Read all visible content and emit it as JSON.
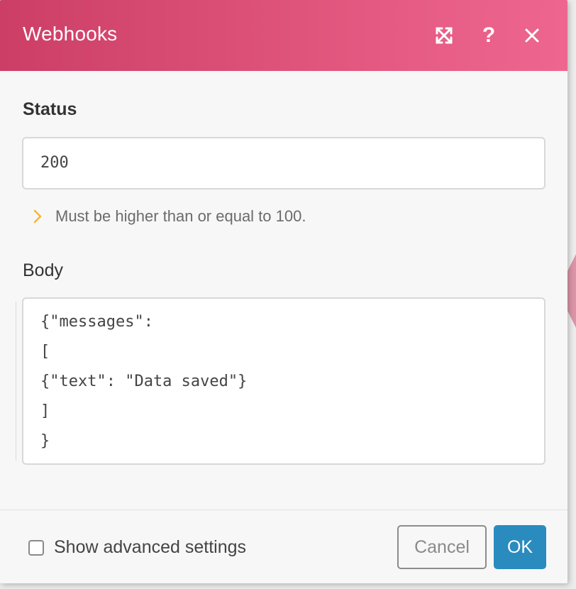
{
  "dialog": {
    "title": "Webhooks",
    "header_color": "#e0557c",
    "icons": {
      "expand": "expand-icon",
      "help": "help-icon",
      "close": "close-icon"
    },
    "help_glyph": "?"
  },
  "status": {
    "label": "Status",
    "value": "200",
    "hint": "Must be higher than or equal to 100.",
    "hint_icon": "chevron-right-icon",
    "hint_color": "#f5b82e"
  },
  "body": {
    "label": "Body",
    "lines": [
      "{\"messages\":",
      "[",
      "{\"text\": \"Data saved\"}",
      "]",
      "}"
    ]
  },
  "footer": {
    "advanced_label": "Show advanced settings",
    "advanced_checked": false,
    "cancel_label": "Cancel",
    "ok_label": "OK",
    "ok_color": "#2a8bbf"
  }
}
